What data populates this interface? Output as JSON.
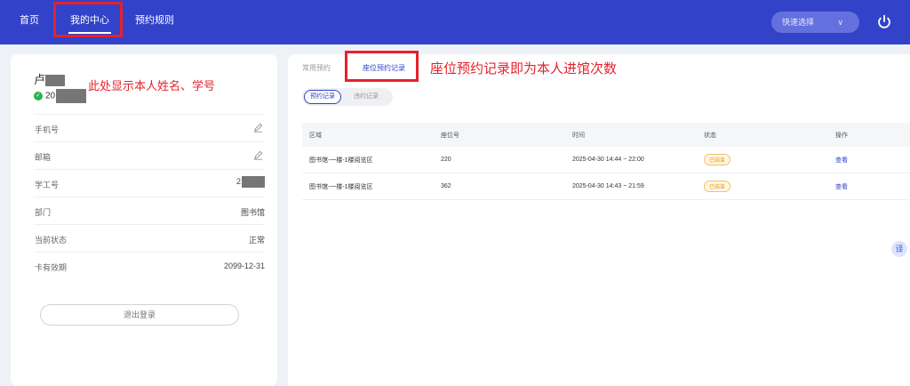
{
  "nav": {
    "home": "首页",
    "my_center": "我的中心",
    "reserve_rules": "预约规则",
    "quick_select": "快速选择"
  },
  "profile": {
    "name_prefix": "卢",
    "id_prefix": "20",
    "annotation": "此处显示本人姓名、学号",
    "rows": [
      {
        "label": "手机号",
        "value": ""
      },
      {
        "label": "邮箱",
        "value": ""
      },
      {
        "label": "学工号",
        "value": "2"
      },
      {
        "label": "部门",
        "value": "图书馆"
      },
      {
        "label": "当前状态",
        "value": "正常"
      },
      {
        "label": "卡有效期",
        "value": "2099-12-31"
      }
    ],
    "logout": "退出登录"
  },
  "tabs": {
    "common": "常用预约",
    "seat_records": "座位预约记录",
    "annotation": "座位预约记录即为本人进馆次数"
  },
  "subtabs": {
    "active": "预约记录",
    "inactive": "违约记录"
  },
  "table": {
    "headers": [
      "区域",
      "座位号",
      "时间",
      "状态",
      "操作"
    ],
    "rows": [
      {
        "area": "图书馆-一楼-1楼阅览区",
        "seat": "220",
        "time": "2025-04-30 14:44 ~ 22:00",
        "status": "已结束",
        "action": "查看"
      },
      {
        "area": "图书馆-一楼-1楼阅览区",
        "seat": "362",
        "time": "2025-04-30 14:43 ~ 21:59",
        "status": "已结束",
        "action": "查看"
      }
    ]
  },
  "float_button": "译",
  "colors": {
    "primary": "#3243c9",
    "annotation_red": "#e5222b",
    "status_orange": "#e59a16",
    "check_green": "#2bb24c"
  },
  "icons": [
    "power-icon",
    "chevron-down-icon",
    "check-icon",
    "edit-icon"
  ]
}
